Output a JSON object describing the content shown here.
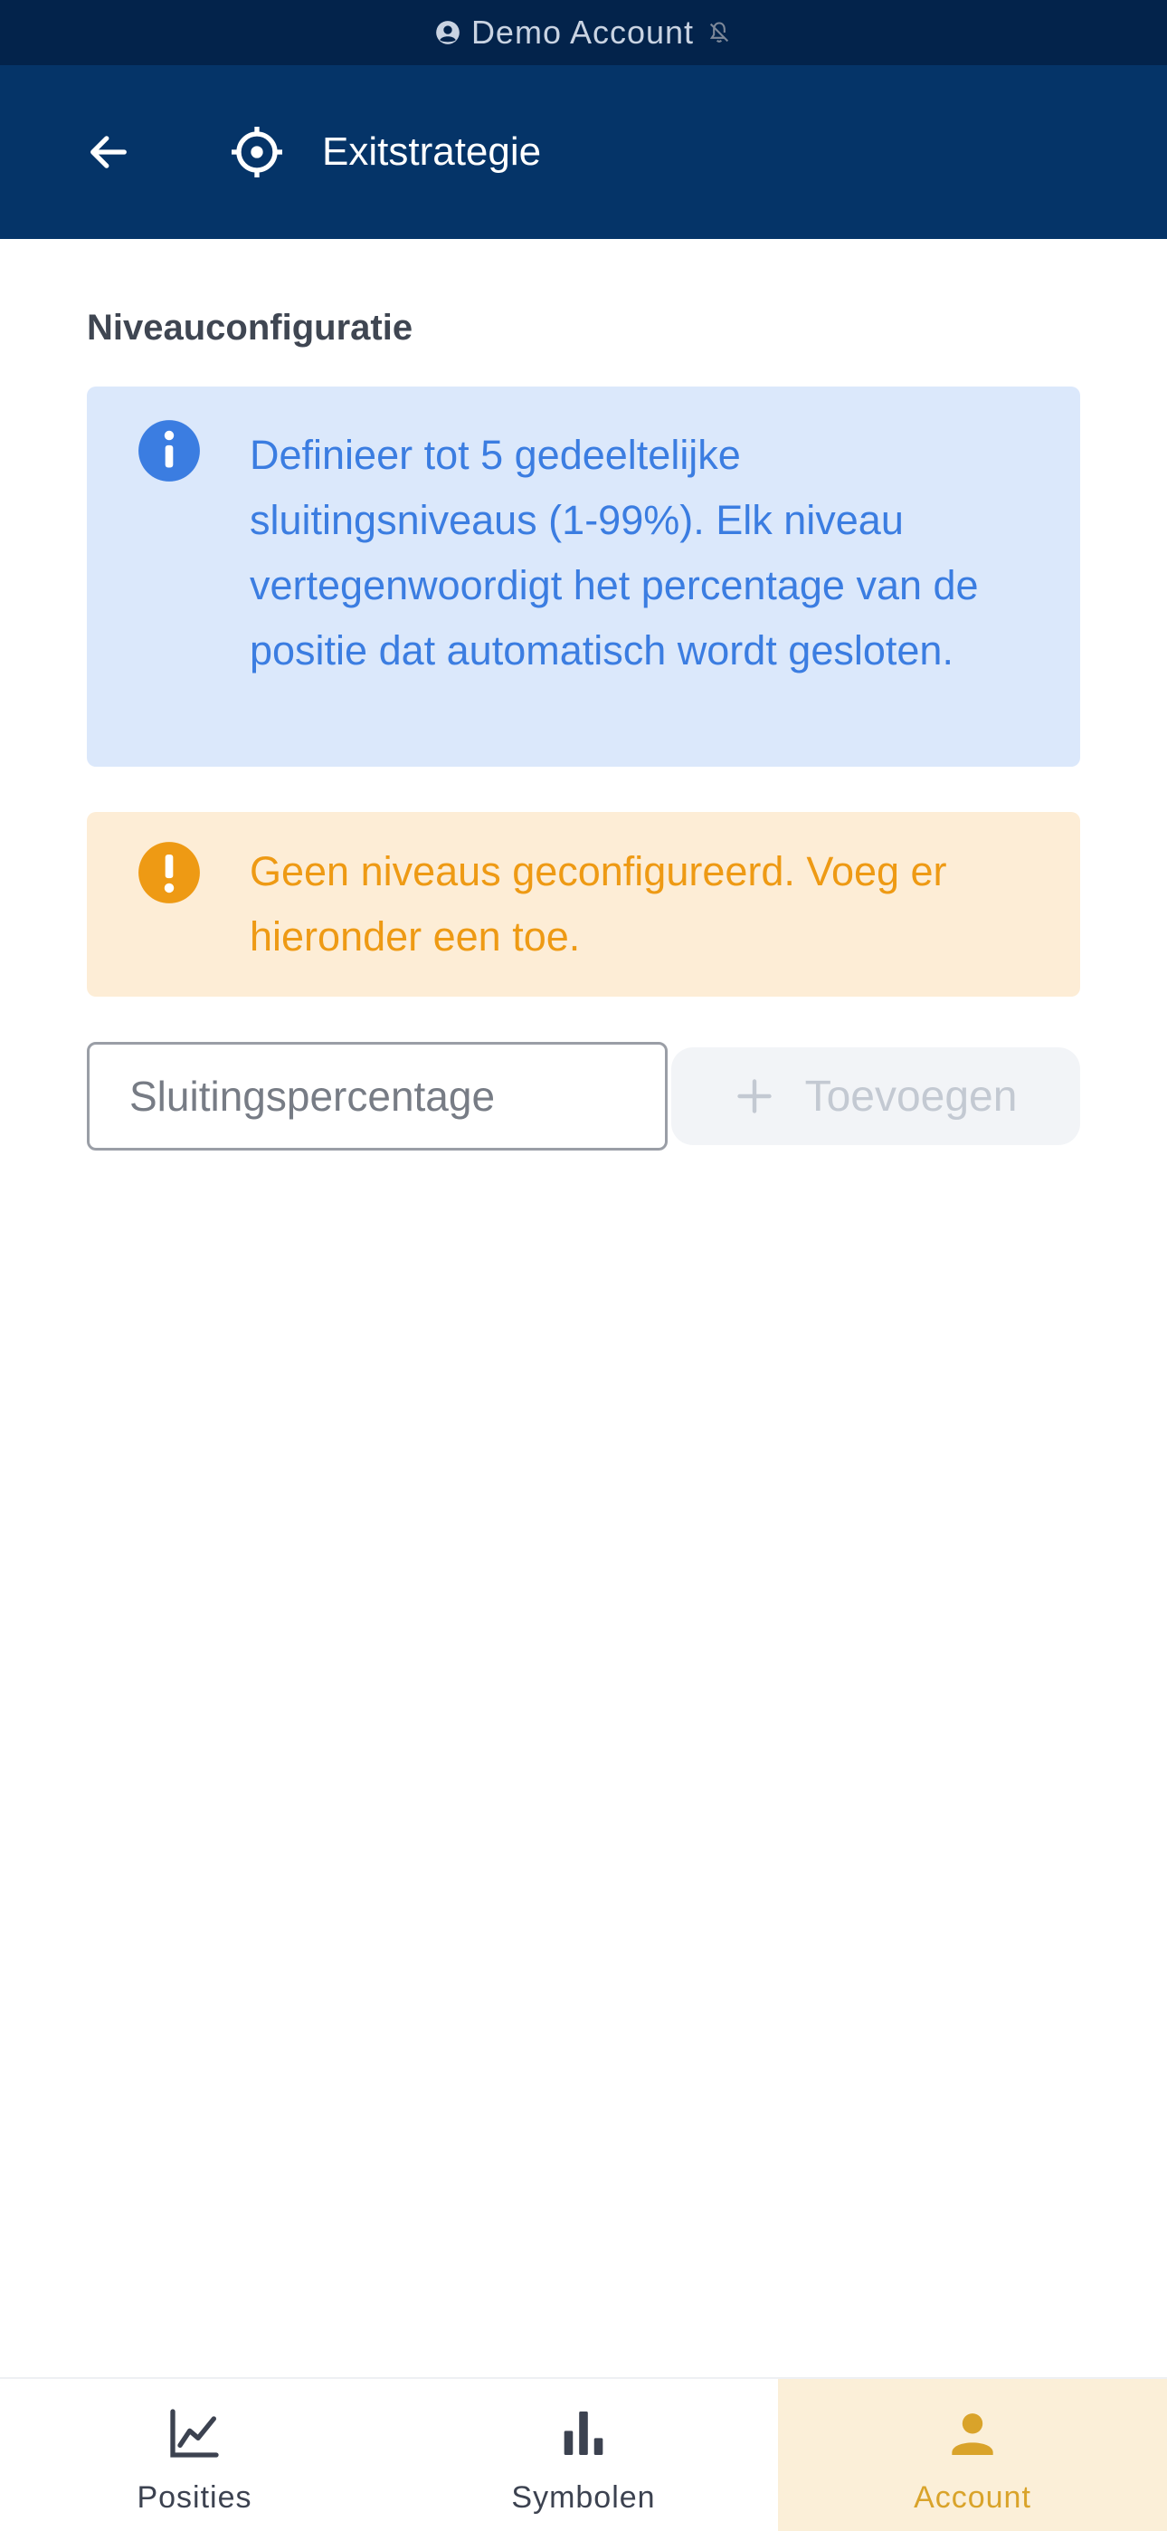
{
  "status_bar": {
    "account_label": "Demo Account",
    "account_icon": "account-circle-icon",
    "mute_icon": "notifications-off-icon"
  },
  "app_bar": {
    "back_icon": "arrow-left-icon",
    "title_icon": "crosshair-target-icon",
    "title": "Exitstrategie"
  },
  "section": {
    "title": "Niveauconfiguratie"
  },
  "info_box": {
    "icon": "info-icon",
    "text": "Definieer tot 5 gedeeltelijke sluitingsniveaus (1-99%). Elk niveau vertegenwoordigt het percentage van de positie dat automatisch wordt gesloten."
  },
  "warning_box": {
    "icon": "warning-icon",
    "text": "Geen niveaus geconfigureerd. Voeg er hieronder een toe."
  },
  "add_level": {
    "input_value": "",
    "input_placeholder": "Sluitingspercentage",
    "button_label": "Toevoegen",
    "button_icon": "plus-icon",
    "button_enabled": false
  },
  "bottom_nav": {
    "items": [
      {
        "label": "Posities",
        "icon": "line-chart-icon",
        "active": false
      },
      {
        "label": "Symbolen",
        "icon": "bar-chart-icon",
        "active": false
      },
      {
        "label": "Account",
        "icon": "person-icon",
        "active": true
      }
    ]
  },
  "colors": {
    "status_bar_bg": "#03234b",
    "app_bar_bg": "#053468",
    "info_bg": "#dbe8fb",
    "info_text": "#3b7de1",
    "warning_bg": "#fdedd6",
    "warning_text": "#ee9a14",
    "active_nav_bg": "#fbefd8",
    "active_nav_text": "#d9a32a"
  }
}
